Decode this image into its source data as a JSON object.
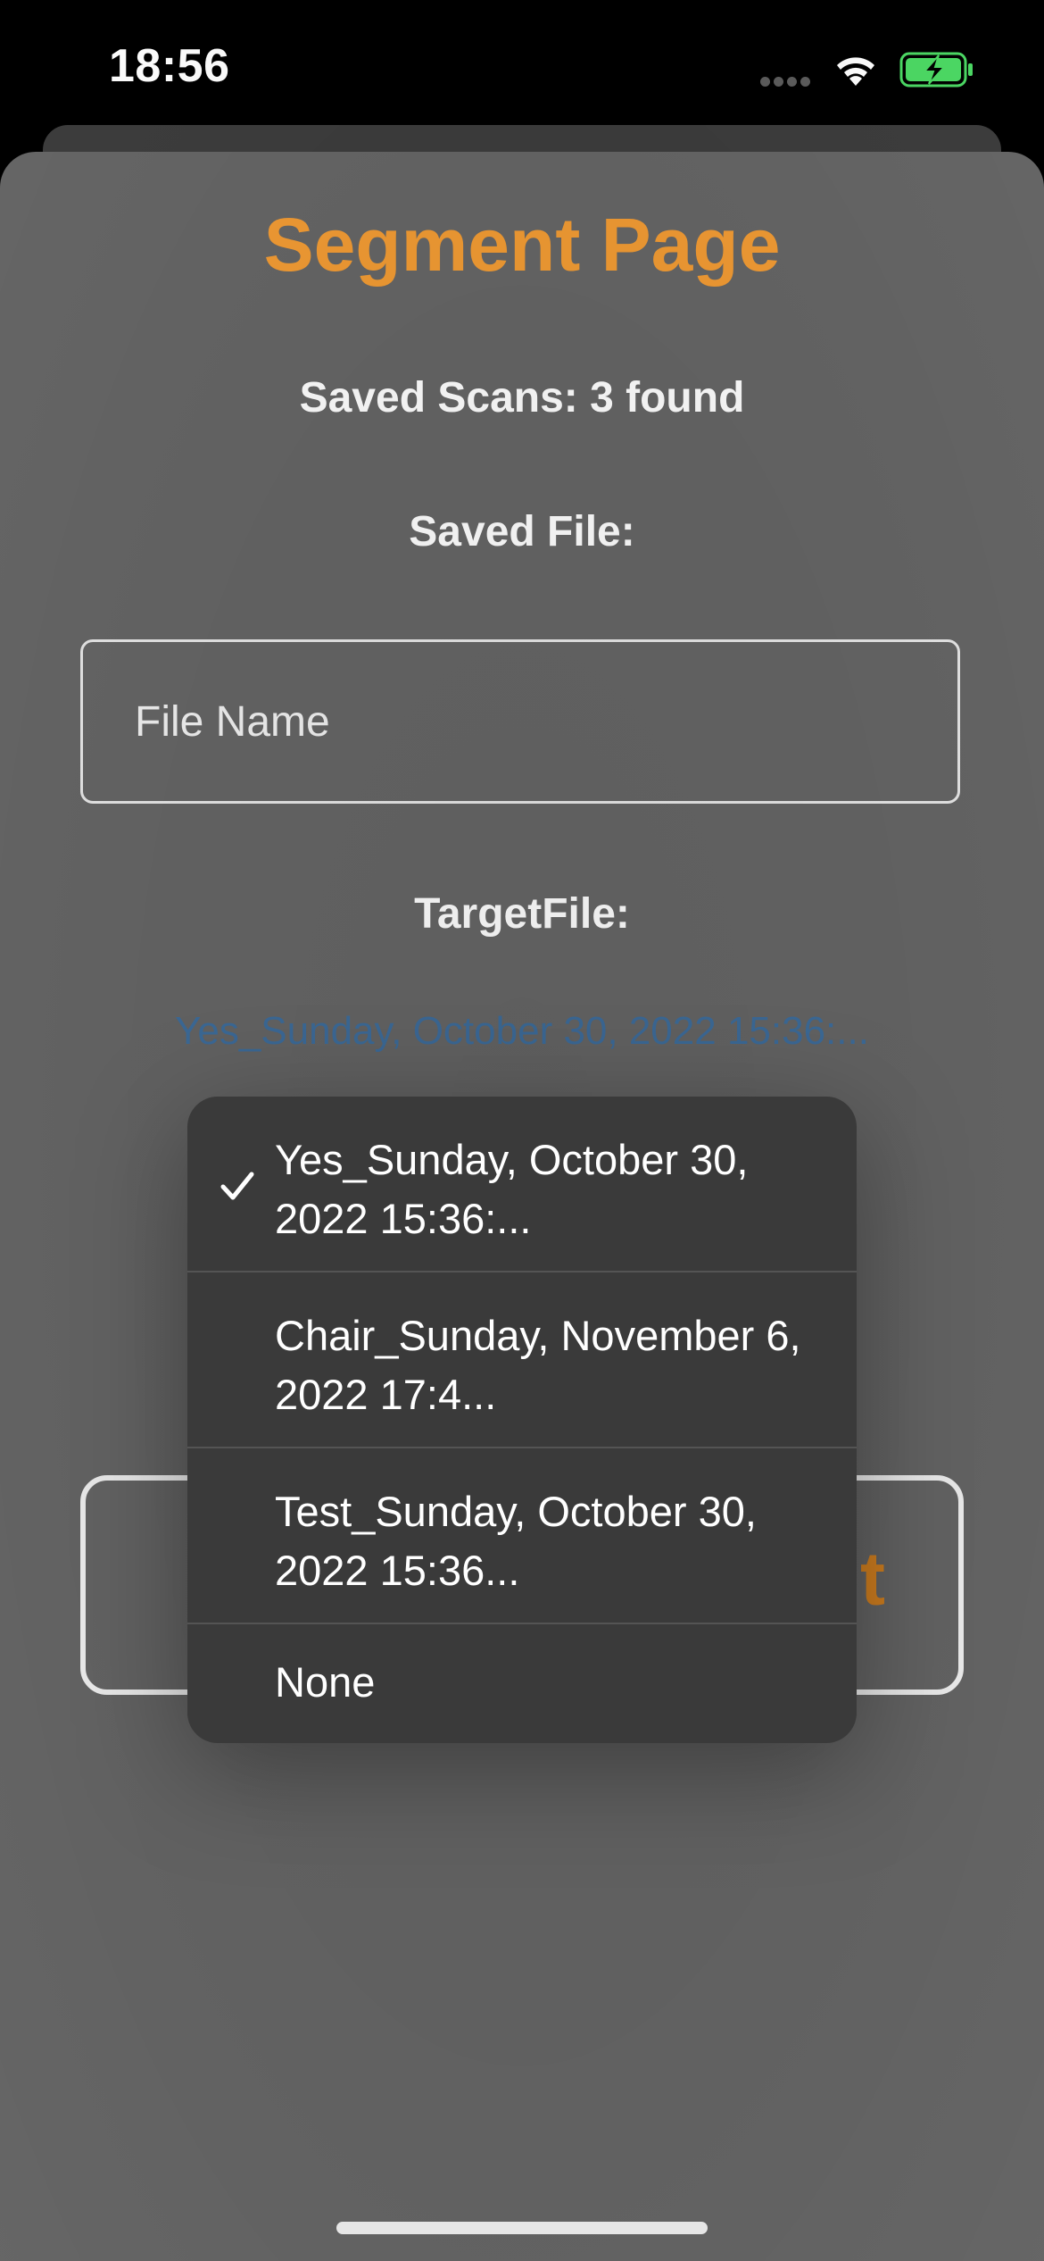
{
  "status_bar": {
    "time": "18:56",
    "icons": [
      "signal-dots-icon",
      "wifi-icon",
      "battery-charging-icon"
    ],
    "battery_color": "#4cd964"
  },
  "page": {
    "title": "Segment Page",
    "saved_scans": "Saved Scans: 3 found",
    "saved_file_label": "Saved File:",
    "file_name_placeholder": "File Name",
    "target_file_label": "TargetFile:",
    "target_file_selected": "Yes_Sunday, October 30, 2022 15:36:...",
    "action_button_visible_text": "t"
  },
  "menu": {
    "items": [
      {
        "label": "Yes_Sunday, October 30, 2022 15:36:...",
        "checked": true
      },
      {
        "label": "Chair_Sunday, November 6, 2022 17:4...",
        "checked": false
      },
      {
        "label": "Test_Sunday, October 30, 2022 15:36...",
        "checked": false
      },
      {
        "label": "None",
        "checked": false
      }
    ]
  },
  "colors": {
    "accent": "#f39c34",
    "link": "#3e6d9c",
    "sheet_background": "#666666",
    "menu_background": "#3a3a3a"
  }
}
